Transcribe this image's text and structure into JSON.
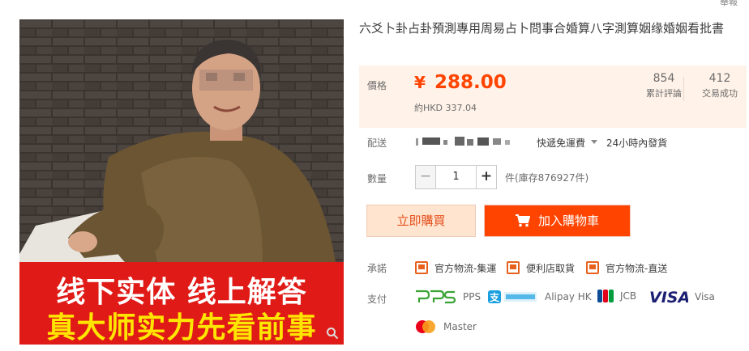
{
  "report_link": "舉報",
  "title": "六爻卜卦占卦預測專用周易占卜問事合婚算八字測算姻缘婚姻看批書",
  "image_banner": {
    "line1": "线下实体  线上解答",
    "line2": "真大师实力先看前事"
  },
  "price": {
    "label": "價格",
    "currency": "¥",
    "value": "288.00",
    "approx": "約HKD 337.04"
  },
  "stats": [
    {
      "num": "854",
      "label": "累計評論"
    },
    {
      "num": "412",
      "label": "交易成功"
    }
  ],
  "shipping": {
    "label": "配送",
    "method": "快遞免運費",
    "time": "24小時內發貨"
  },
  "quantity": {
    "label": "數量",
    "minus": "−",
    "value": "1",
    "plus": "+",
    "stock": "件(庫存876927件)"
  },
  "buttons": {
    "buy_now": "立即購買",
    "add_cart": "加入購物車"
  },
  "promise": {
    "label": "承諾",
    "items": [
      "官方物流-集運",
      "便利店取貨",
      "官方物流-直送"
    ]
  },
  "payment": {
    "label": "支付",
    "pps": "PPS",
    "alipay": "Alipay HK",
    "jcb": "JCB",
    "visa": "Visa",
    "master": "Master"
  },
  "colors": {
    "accent": "#ff4400",
    "price_bg": "#fff2e8",
    "banner_red": "#e01a17",
    "banner_yellow": "#ffe600"
  }
}
